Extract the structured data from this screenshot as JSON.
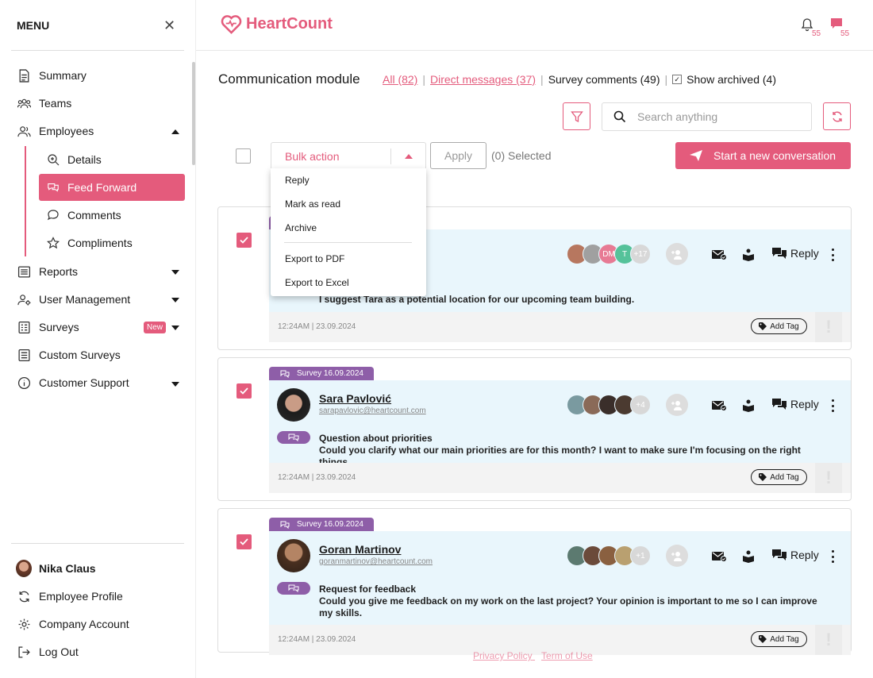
{
  "sidebar": {
    "title": "MENU",
    "items": [
      {
        "label": "Summary"
      },
      {
        "label": "Teams"
      },
      {
        "label": "Employees"
      },
      {
        "label": "Reports"
      },
      {
        "label": "User Management"
      },
      {
        "label": "Surveys",
        "badge": "New"
      },
      {
        "label": "Custom Surveys"
      },
      {
        "label": "Customer Support"
      }
    ],
    "sub_items": [
      {
        "label": "Details"
      },
      {
        "label": "Feed Forward"
      },
      {
        "label": "Comments"
      },
      {
        "label": "Compliments"
      }
    ],
    "user": {
      "name": "Nika Claus",
      "links": [
        "Employee Profile",
        "Company Account",
        "Log Out"
      ]
    }
  },
  "header": {
    "brand": "HeartCount",
    "notifications_count": "55",
    "messages_count": "55"
  },
  "main": {
    "title": "Communication module",
    "filters": {
      "all": "All (82)",
      "direct": "Direct messages (37)",
      "survey": "Survey comments (49)",
      "archived": "Show archived (4)"
    },
    "search_placeholder": "Search anything",
    "bulk_action": "Bulk action",
    "apply": "Apply",
    "selected": "(0) Selected",
    "start_conversation": "Start a new conversation",
    "bulk_menu": [
      "Reply",
      "Mark as read",
      "Archive",
      "Export to PDF",
      "Export to Excel"
    ],
    "reply_label": "Reply",
    "add_tag": "Add Tag",
    "cards": [
      {
        "message": "I suggest Tara as a potential location for our upcoming team building.",
        "time": "12:24AM | 23.09.2024",
        "participants": [
          "DM",
          "T"
        ],
        "more": "+17"
      },
      {
        "tag": "Survey 16.09.2024",
        "name": "Sara Pavlović",
        "email": "sarapavlovic@heartcount.com",
        "title": "Question about priorities",
        "message": "Could you clarify what our main priorities are for this month? I want to make sure I'm focusing on the right things.",
        "time": "12:24AM | 23.09.2024",
        "more": "+4"
      },
      {
        "tag": "Survey 16.09.2024",
        "name": "Goran Martinov",
        "email": "goranmartinov@heartcount.com",
        "title": "Request for feedback",
        "message": "Could you give me feedback on my work on the last project? Your opinion is important to me so I can improve my skills.",
        "time": "12:24AM | 23.09.2024",
        "more": "+1"
      }
    ]
  },
  "footer": {
    "privacy": "Privacy Policy",
    "terms": "Term of Use"
  },
  "colors": {
    "accent": "#e45b7c",
    "survey_tag": "#8e5ea8",
    "card_bg": "#e9f6fc"
  }
}
